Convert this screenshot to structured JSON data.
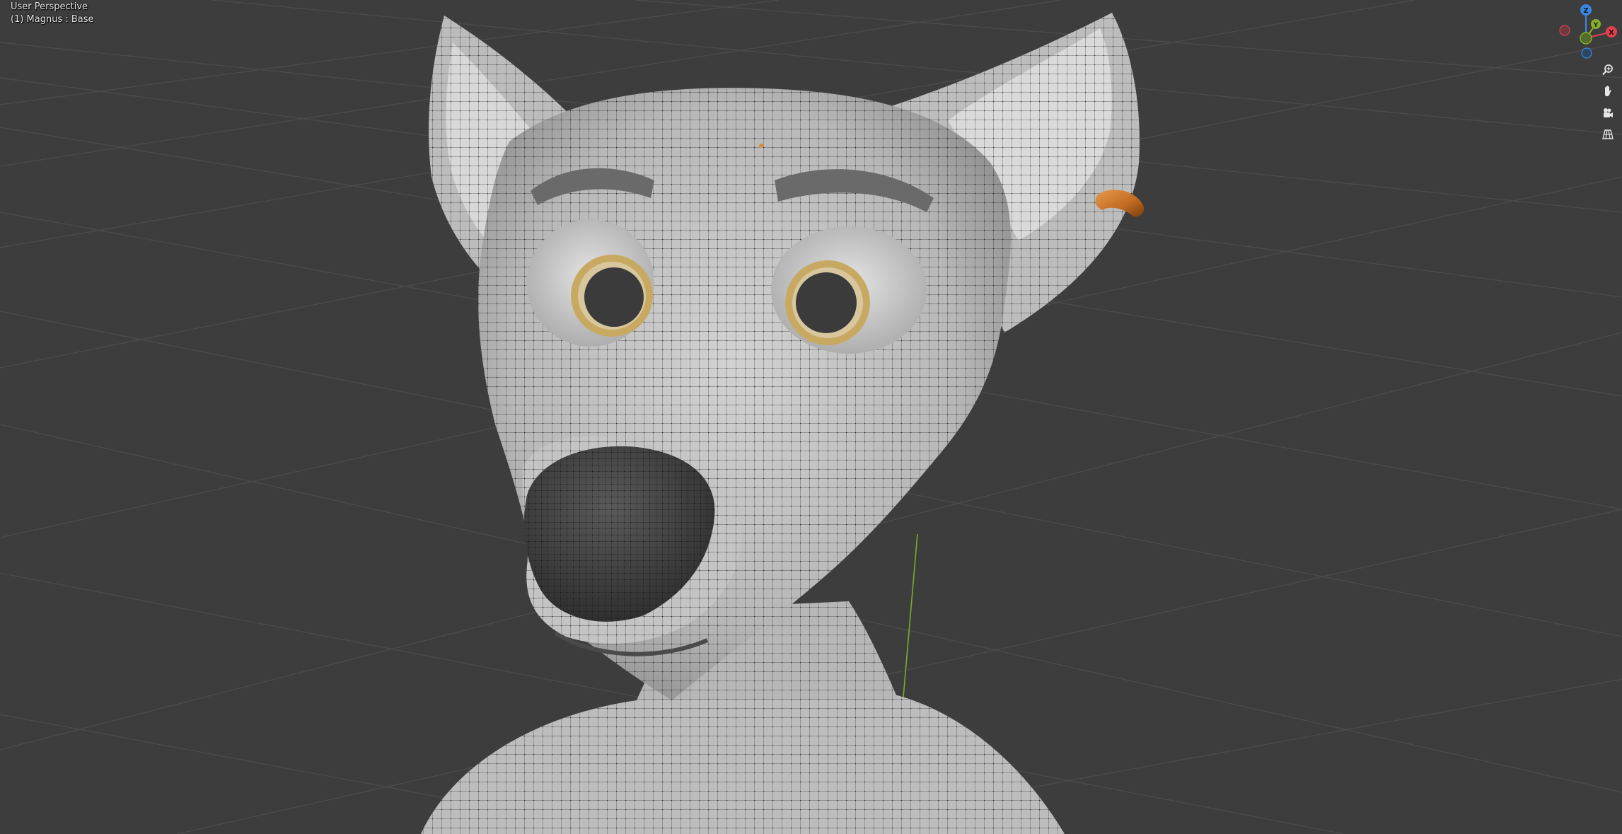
{
  "viewport": {
    "view_label": "User Perspective",
    "object_label": "(1) Magnus : Base"
  },
  "gizmo": {
    "axis_z": "Z",
    "axis_y": "Y",
    "axis_x": "X",
    "colors": {
      "x": "#e0404f",
      "y": "#84b02c",
      "z": "#3b86e0"
    }
  },
  "navigation": {
    "zoom_icon": "zoom-icon",
    "pan_icon": "hand-pan-icon",
    "camera_icon": "camera-view-icon",
    "ortho_icon": "perspective-grid-icon"
  },
  "scene": {
    "background": "#3d3d3d",
    "grid_color": "#4a4a4a",
    "mesh_color": "#c9c9c9",
    "nose_color": "#3b3b3b",
    "iris_color": "#c8a962",
    "earring_color": "#c9722a"
  }
}
